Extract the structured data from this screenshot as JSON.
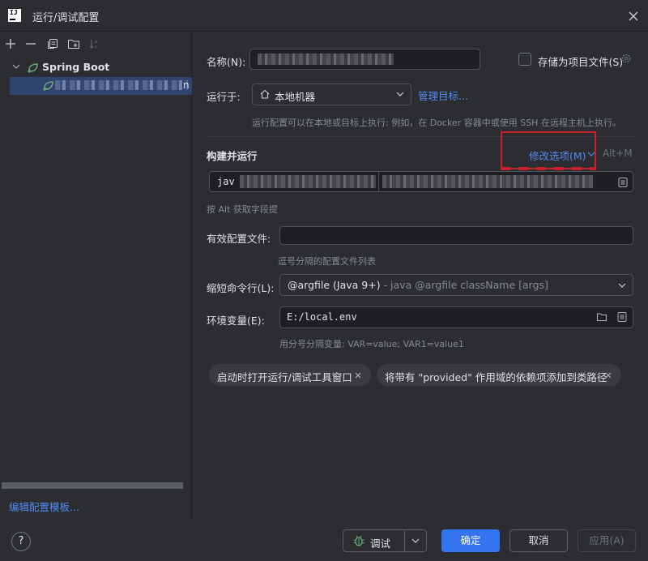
{
  "window": {
    "title": "运行/调试配置",
    "logo_text": "IJ"
  },
  "toolbar": {
    "icons": [
      "add-icon",
      "remove-icon",
      "copy-icon",
      "new-folder-icon",
      "sort-icon"
    ]
  },
  "tree": {
    "root_label": "Spring Boot",
    "child_suffix": "n"
  },
  "left_footer": {
    "edit_templates": "编辑配置模板..."
  },
  "form": {
    "name_label": "名称(N):",
    "store_label": "存储为项目文件(S)",
    "run_on_label": "运行于:",
    "run_on_value": "本地机器",
    "manage_targets": "管理目标...",
    "run_on_hint": "运行配置可以在本地或目标上执行: 例如，在 Docker 容器中或使用 SSH 在远程主机上执行。",
    "build_run_title": "构建并运行",
    "modify_options": "修改选项(M)",
    "modify_shortcut": "Alt+M",
    "build_prefix": "jav",
    "build_hint": "按 Alt 获取字段提",
    "active_profiles_label": "有效配置文件:",
    "active_profiles_value": "",
    "active_profiles_hint": "逗号分隔的配置文件列表",
    "shorten_label": "缩短命令行(L):",
    "shorten_value": "@argfile (Java 9+)",
    "shorten_hint": " - java @argfile className [args]",
    "env_label": "环境变量(E):",
    "env_value": "E:/local.env",
    "env_hint": "用分号分隔变量: VAR=value; VAR1=value1"
  },
  "chips": [
    {
      "label": "启动时打开运行/调试工具窗口"
    },
    {
      "label": "将带有 \"provided\" 作用域的依赖项添加到类路径"
    }
  ],
  "buttons": {
    "help": "?",
    "debug": "调试",
    "ok": "确定",
    "cancel": "取消",
    "apply": "应用(A)"
  },
  "colors": {
    "accent": "#3574f0",
    "link": "#548af7",
    "highlight_box": "#c4232b",
    "spring_green": "#6aab73"
  }
}
